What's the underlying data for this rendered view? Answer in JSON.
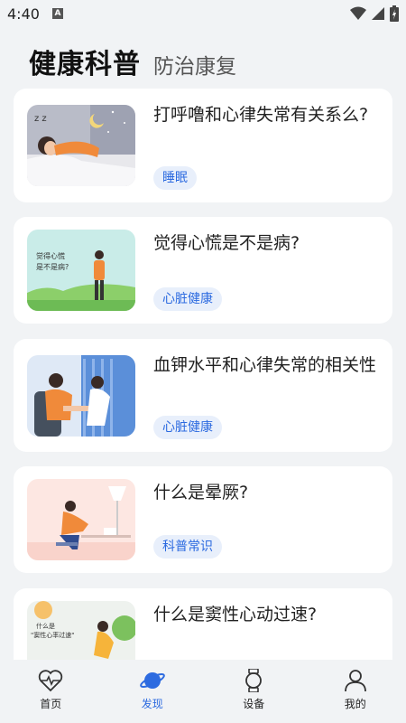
{
  "status": {
    "time": "4:40",
    "badge": "A"
  },
  "header": {
    "title": "健康科普",
    "subtitle": "防治康复"
  },
  "articles": [
    {
      "title": "打呼噜和心律失常有关系么?",
      "tag": "睡眠"
    },
    {
      "title": "觉得心慌是不是病?",
      "tag": "心脏健康",
      "thumb_text": "觉得心慌\n是不是病?"
    },
    {
      "title": "血钾水平和心律失常的相关性",
      "tag": "心脏健康"
    },
    {
      "title": "什么是晕厥?",
      "tag": "科普常识"
    },
    {
      "title": "什么是窦性心动过速?",
      "tag": "",
      "thumb_text": "什么是\n\"窦性心率过速\""
    }
  ],
  "nav": [
    {
      "label": "首页",
      "icon": "heart-pulse-icon"
    },
    {
      "label": "发现",
      "icon": "planet-icon",
      "active": true
    },
    {
      "label": "设备",
      "icon": "watch-icon"
    },
    {
      "label": "我的",
      "icon": "user-icon"
    }
  ],
  "colors": {
    "accent": "#2d6be0",
    "tag_bg": "#e8effb",
    "background": "#f1f3f5"
  }
}
